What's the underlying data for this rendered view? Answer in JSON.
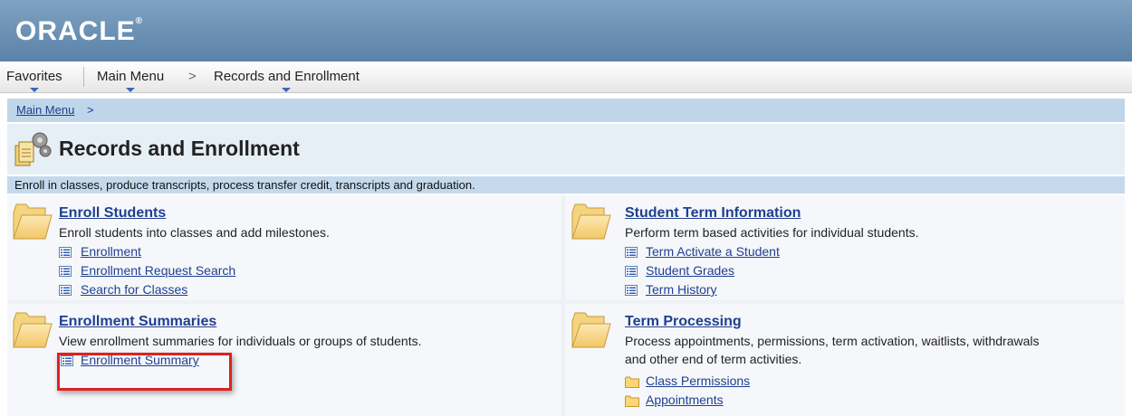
{
  "header": {
    "logo_text": "ORACLE",
    "logo_mark": "®"
  },
  "navbar": {
    "items": [
      {
        "label": "Favorites"
      },
      {
        "label": "Main Menu"
      },
      {
        "label": "Records and Enrollment"
      }
    ],
    "separator": ">"
  },
  "breadcrumb": {
    "link": "Main Menu",
    "separator": ">"
  },
  "page": {
    "title": "Records and Enrollment",
    "description": "Enroll in classes, produce transcripts, process transfer credit, transcripts and graduation."
  },
  "sections": [
    {
      "title": "Enroll Students",
      "description": "Enroll students into classes and add milestones.",
      "links": [
        "Enrollment",
        "Enrollment Request Search",
        "Search for Classes"
      ]
    },
    {
      "title": "Student Term Information",
      "description": "Perform term based activities for individual students.",
      "links": [
        "Term Activate a Student",
        "Student Grades",
        "Term History"
      ]
    },
    {
      "title": "Enrollment Summaries",
      "description": "View enrollment summaries for individuals or groups of students.",
      "links": [
        "Enrollment Summary"
      ]
    },
    {
      "title": "Term Processing",
      "description_line1": "Process appointments, permissions, term activation, waitlists, withdrawals",
      "description_line2": "and other end of term activities.",
      "links": [
        "Class Permissions",
        "Appointments"
      ]
    }
  ],
  "colors": {
    "header": "#6b8fb5",
    "link": "#1f3f91",
    "highlight": "#e02020"
  }
}
